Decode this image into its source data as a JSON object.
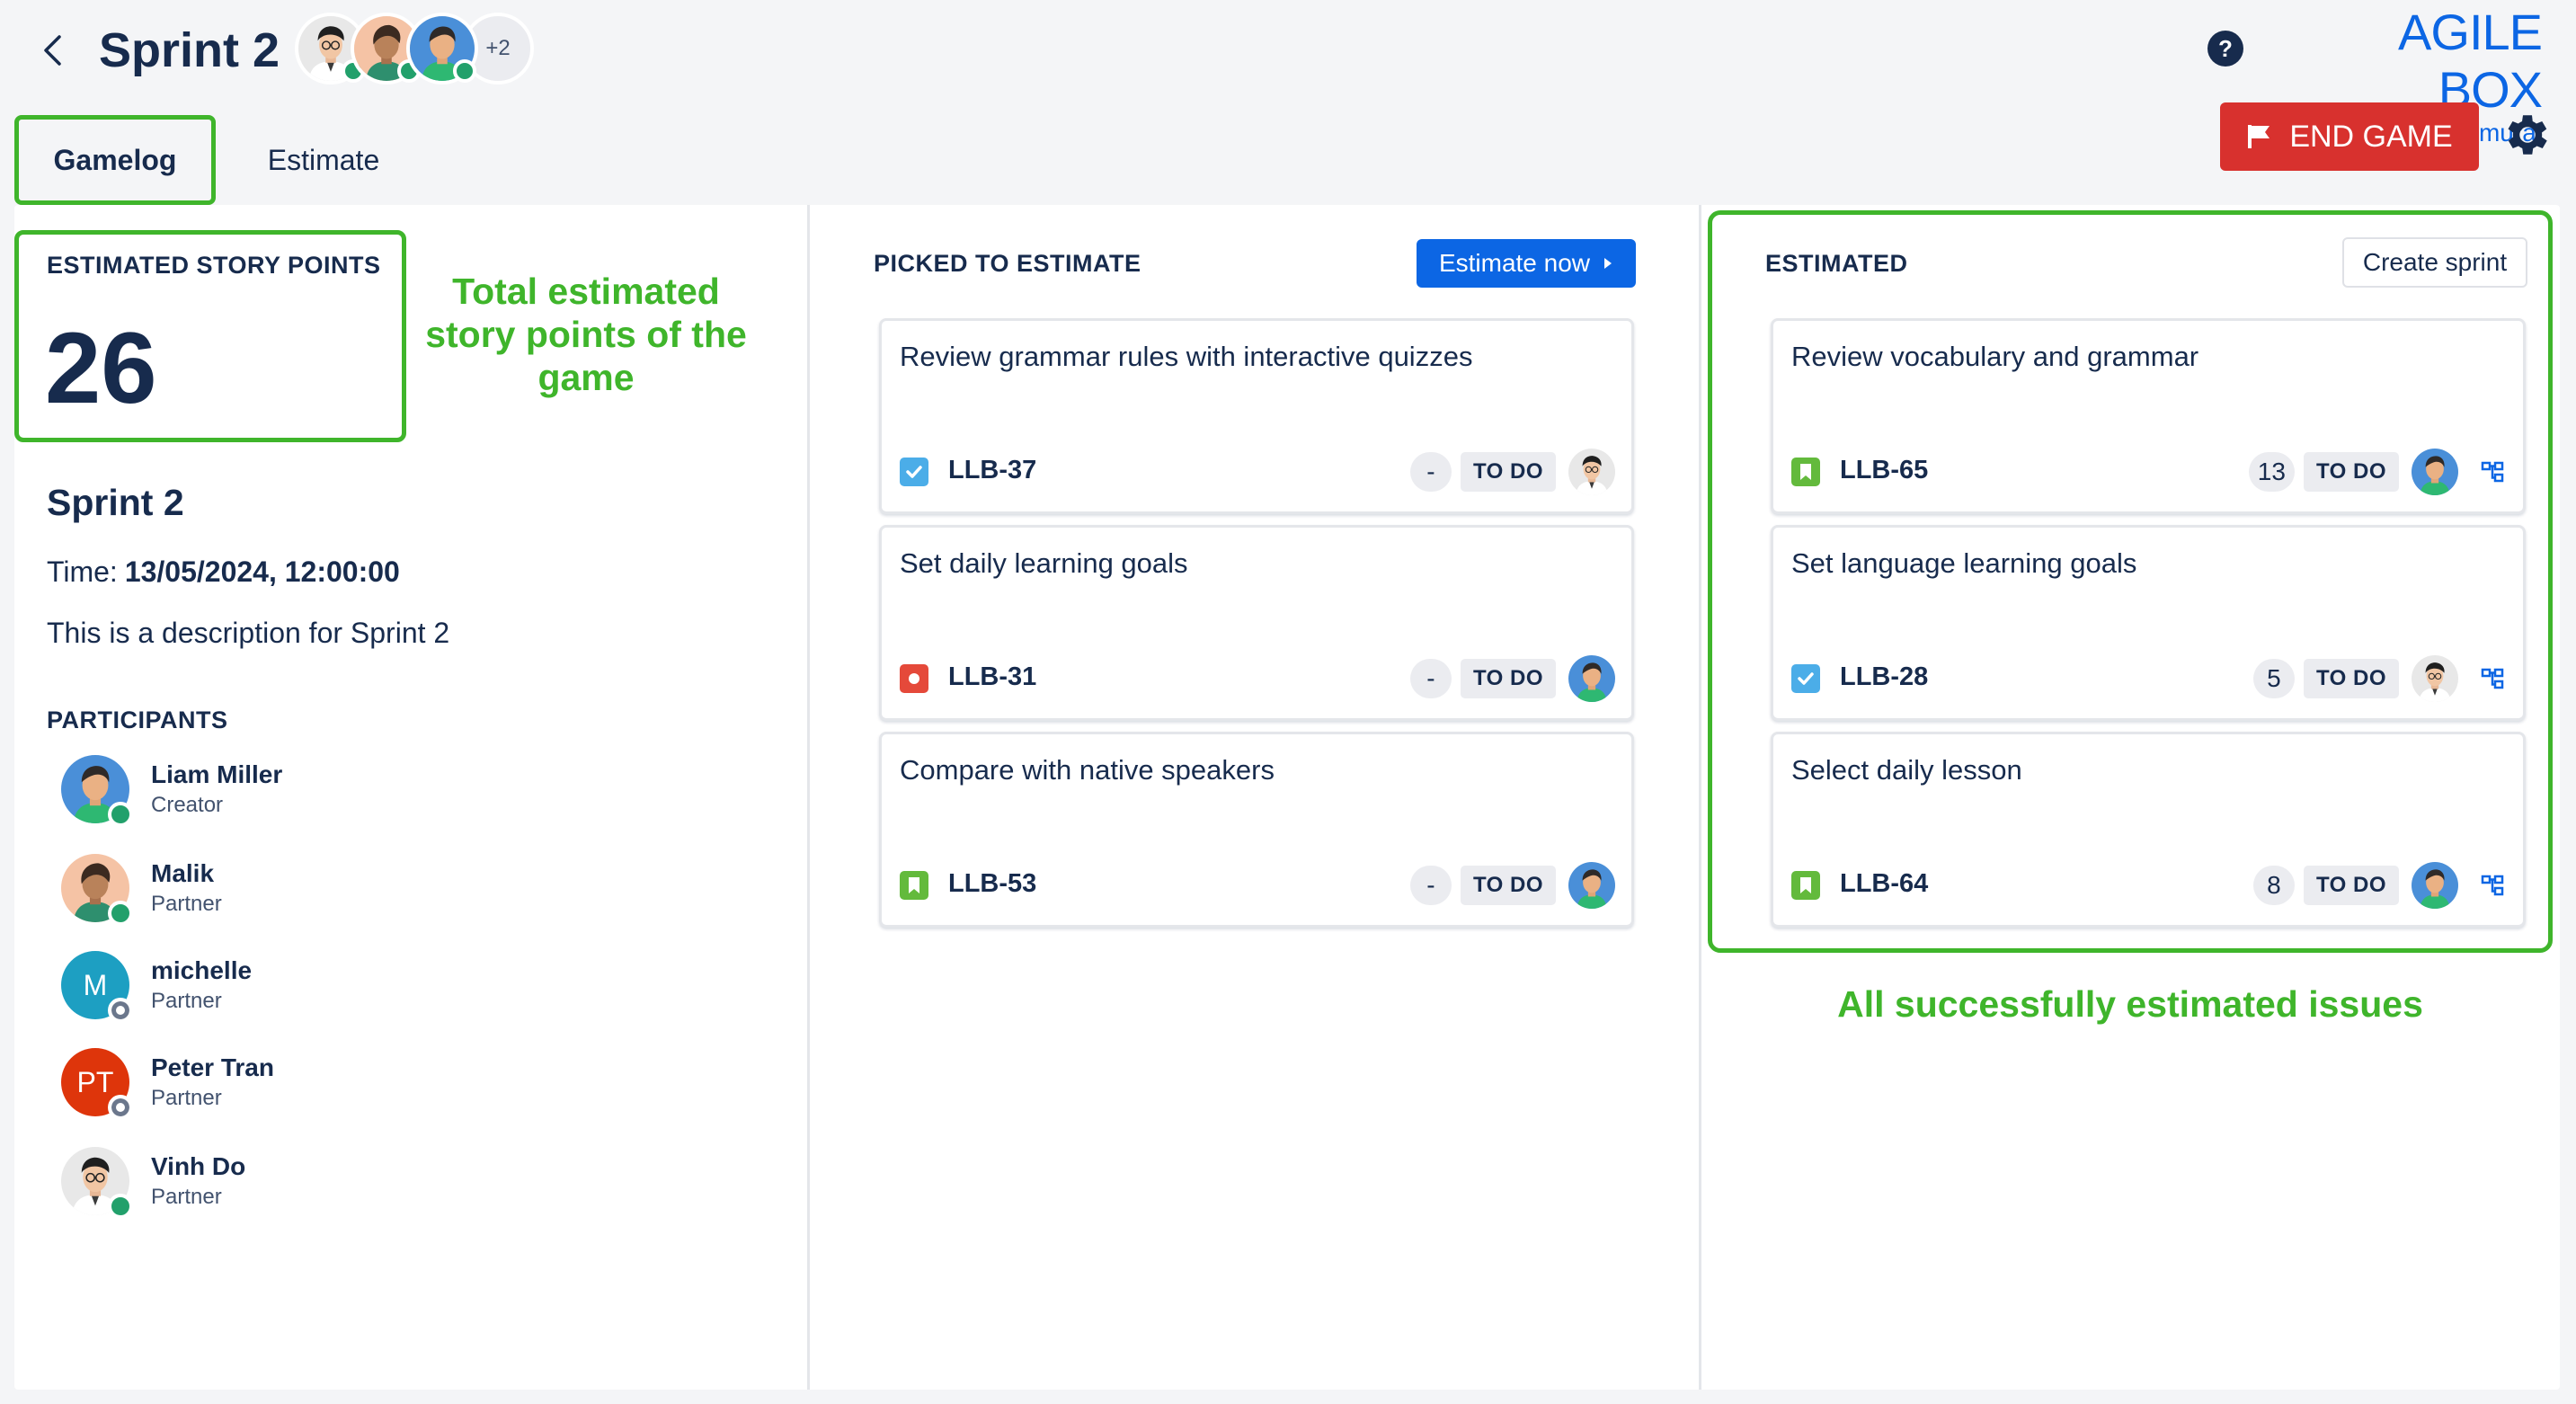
{
  "header": {
    "title": "Sprint 2",
    "avatars_more": "+2",
    "brand_name": "AGILE BOX",
    "brand_by": "by DevSamurai",
    "help": "?",
    "end_game_label": "END GAME"
  },
  "tabs": [
    {
      "label": "Gamelog",
      "active": true
    },
    {
      "label": "Estimate",
      "active": false
    }
  ],
  "left": {
    "story_points_label": "ESTIMATED STORY POINTS",
    "story_points_value": "26",
    "callout": "Total estimated story points of the game",
    "sprint_name": "Sprint 2",
    "time_label": "Time:",
    "time_value": "13/05/2024, 12:00:00",
    "description": "This is a description for Sprint 2",
    "participants_label": "PARTICIPANTS",
    "participants": [
      {
        "name": "Liam Miller",
        "role": "Creator",
        "status": "online",
        "avatar": "avatar-blue"
      },
      {
        "name": "Malik",
        "role": "Partner",
        "status": "online",
        "avatar": "avatar-peach"
      },
      {
        "name": "michelle",
        "role": "Partner",
        "status": "offline",
        "initials": "M",
        "color": "#1d9fc2"
      },
      {
        "name": "Peter Tran",
        "role": "Partner",
        "status": "offline",
        "initials": "PT",
        "color": "#de350b"
      },
      {
        "name": "Vinh Do",
        "role": "Partner",
        "status": "online",
        "avatar": "avatar-glasses"
      }
    ]
  },
  "picked": {
    "title": "PICKED TO ESTIMATE",
    "estimate_now_label": "Estimate now",
    "cards": [
      {
        "title": "Review grammar rules with interactive quizzes",
        "key": "LLB-37",
        "type": "task",
        "points": "-",
        "status": "TO DO",
        "avatar": "avatar-glasses"
      },
      {
        "title": "Set daily learning goals",
        "key": "LLB-31",
        "type": "bug",
        "points": "-",
        "status": "TO DO",
        "avatar": "avatar-blue"
      },
      {
        "title": "Compare with native speakers",
        "key": "LLB-53",
        "type": "story",
        "points": "-",
        "status": "TO DO",
        "avatar": "avatar-blue"
      }
    ]
  },
  "estimated": {
    "title": "ESTIMATED",
    "create_sprint_label": "Create sprint",
    "callout": "All successfully estimated issues",
    "cards": [
      {
        "title": "Review vocabulary and grammar",
        "key": "LLB-65",
        "type": "story",
        "points": "13",
        "status": "TO DO",
        "avatar": "avatar-blue"
      },
      {
        "title": "Set language learning goals",
        "key": "LLB-28",
        "type": "task",
        "points": "5",
        "status": "TO DO",
        "avatar": "avatar-glasses"
      },
      {
        "title": "Select daily lesson",
        "key": "LLB-64",
        "type": "story",
        "points": "8",
        "status": "TO DO",
        "avatar": "avatar-blue"
      }
    ]
  },
  "colors": {
    "accent_green": "#3fb52b",
    "primary_blue": "#0c66e4",
    "danger_red": "#d8312e",
    "text_dark": "#172b4d",
    "task_blue": "#4bade8",
    "bug_red": "#e5493a",
    "story_green": "#63ba3c"
  }
}
